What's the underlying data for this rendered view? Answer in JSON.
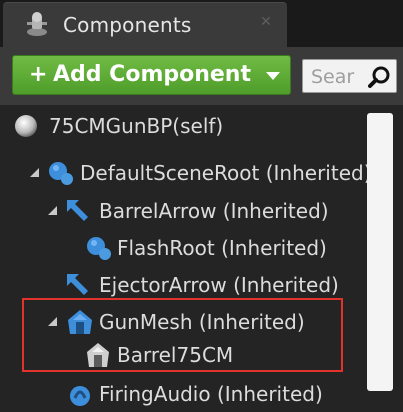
{
  "tab": {
    "title": "Components",
    "close_glyph": "✕",
    "icon": "components-icon"
  },
  "toolbar": {
    "add_plus": "+",
    "add_label": "Add Component",
    "add_dropdown_icon": "chevron-down-icon",
    "search_placeholder": "Sear",
    "search_icon": "search-icon"
  },
  "tree": {
    "items": [
      {
        "label": "75CMGunBP(self)",
        "icon": "sphere-icon"
      },
      {
        "label": "DefaultSceneRoot (Inherited)",
        "icon": "scene-root-icon"
      },
      {
        "label": "BarrelArrow (Inherited)",
        "icon": "arrow-component-icon"
      },
      {
        "label": "FlashRoot (Inherited)",
        "icon": "scene-root-icon"
      },
      {
        "label": "EjectorArrow (Inherited)",
        "icon": "arrow-component-icon"
      },
      {
        "label": "GunMesh (Inherited)",
        "icon": "skeletal-mesh-icon"
      },
      {
        "label": "Barrel75CM",
        "icon": "static-mesh-icon"
      },
      {
        "label": "FiringAudio (Inherited)",
        "icon": "audio-icon"
      }
    ]
  },
  "colors": {
    "add_button": "#5aa832",
    "highlight_border": "#e2322c",
    "panel_bg": "#242424",
    "toolbar_bg": "#3a3a3a",
    "icon_blue": "#4a9be0"
  }
}
